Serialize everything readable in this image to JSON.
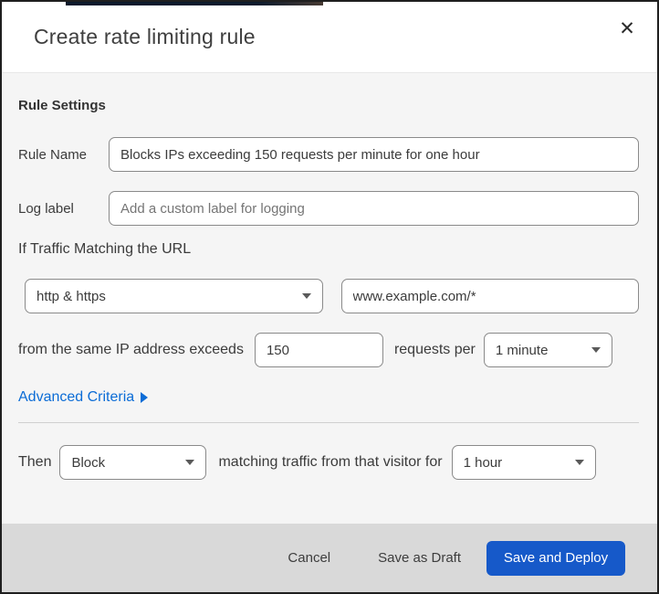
{
  "dialog": {
    "title": "Create rate limiting rule",
    "close_glyph": "✕"
  },
  "rule_settings": {
    "heading": "Rule Settings",
    "rule_name": {
      "label": "Rule Name",
      "value": "Blocks IPs exceeding 150 requests per minute for one hour"
    },
    "log_label": {
      "label": "Log label",
      "placeholder": "Add a custom label for logging"
    }
  },
  "traffic_match": {
    "heading": "If Traffic Matching the URL",
    "scheme_select": {
      "value": "http & https"
    },
    "url_input": {
      "value": "www.example.com/*"
    },
    "threshold": {
      "prefix_text": "from the same IP address exceeds",
      "count_value": "150",
      "middle_text": "requests per",
      "period_select": {
        "value": "1 minute"
      }
    },
    "advanced_link": {
      "label": "Advanced Criteria"
    }
  },
  "then_action": {
    "label": "Then",
    "action_select": {
      "value": "Block"
    },
    "middle_text": "matching traffic from that visitor for",
    "duration_select": {
      "value": "1 hour"
    }
  },
  "footer": {
    "cancel_label": "Cancel",
    "save_draft_label": "Save as Draft",
    "save_deploy_label": "Save and Deploy"
  },
  "colors": {
    "primary_button": "#1659c9",
    "link_blue": "#0b6cd6",
    "footer_bg": "#d9d9d9",
    "body_bg": "#f5f5f5"
  }
}
